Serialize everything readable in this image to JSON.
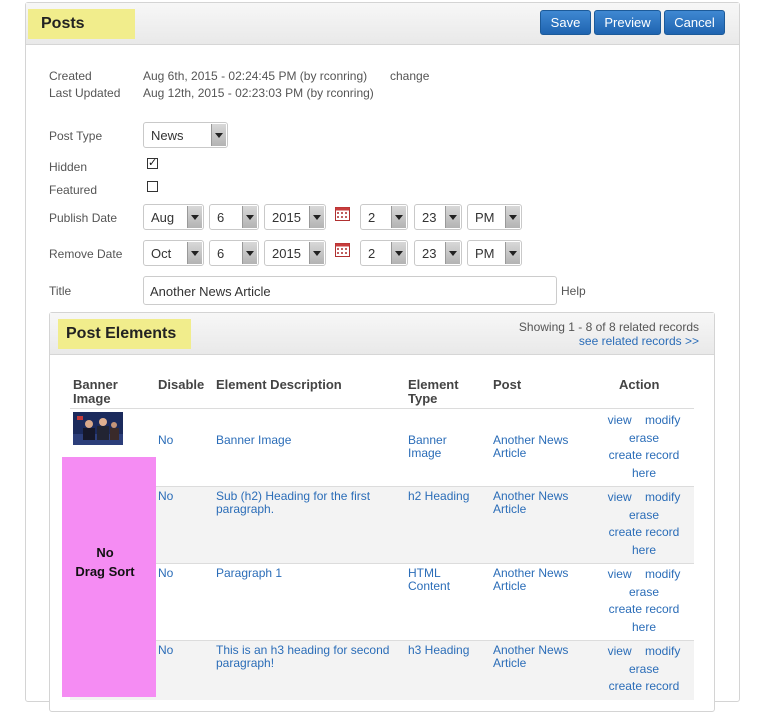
{
  "header": {
    "title": "Posts",
    "save_label": "Save",
    "preview_label": "Preview",
    "cancel_label": "Cancel"
  },
  "meta": {
    "created_label": "Created",
    "created_value": "Aug 6th, 2015 - 02:24:45 PM (by rconring)",
    "change_link": "change",
    "updated_label": "Last Updated",
    "updated_value": "Aug 12th, 2015 - 02:23:03 PM (by rconring)"
  },
  "form": {
    "post_type_label": "Post Type",
    "post_type_value": "News",
    "hidden_label": "Hidden",
    "hidden_checked": "✓",
    "featured_label": "Featured",
    "publish_label": "Publish Date",
    "publish": {
      "month": "Aug",
      "day": "6",
      "year": "2015",
      "hour": "2",
      "minute": "23",
      "ampm": "PM"
    },
    "remove_label": "Remove Date",
    "remove": {
      "month": "Oct",
      "day": "6",
      "year": "2015",
      "hour": "2",
      "minute": "23",
      "ampm": "PM"
    },
    "title_label": "Title",
    "title_value": "Another News Article",
    "help_link": "Help"
  },
  "elements": {
    "title": "Post Elements",
    "showing": "Showing 1 - 8 of 8 related records",
    "see_related": "see related records >>",
    "columns": {
      "banner_line1": "Banner",
      "banner_line2": "Image",
      "disable": "Disable",
      "description": "Element Description",
      "type_line1": "Element",
      "type_line2": "Type",
      "post": "Post",
      "action": "Action"
    },
    "rows": [
      {
        "disable": "No",
        "description": "Banner Image",
        "type": "Banner Image",
        "post": "Another News Article"
      },
      {
        "disable": "No",
        "description": "Sub (h2) Heading for the first paragraph.",
        "type": "h2 Heading",
        "post": "Another News Article"
      },
      {
        "disable": "No",
        "description": "Paragraph 1",
        "type": "HTML Content",
        "post": "Another News Article"
      },
      {
        "disable": "No",
        "description": "This is an h3 heading for second paragraph!",
        "type": "h3 Heading",
        "post": "Another News Article"
      }
    ],
    "actions": {
      "view": "view",
      "modify": "modify",
      "erase": "erase",
      "create": "create record",
      "here": "here"
    },
    "drag_line1": "No",
    "drag_line2": "Drag Sort"
  },
  "colors": {
    "highlight": "#f1ed8c",
    "button": "#2a73c0",
    "drag_zone": "#f58cf3",
    "link": "#2b6db8"
  }
}
